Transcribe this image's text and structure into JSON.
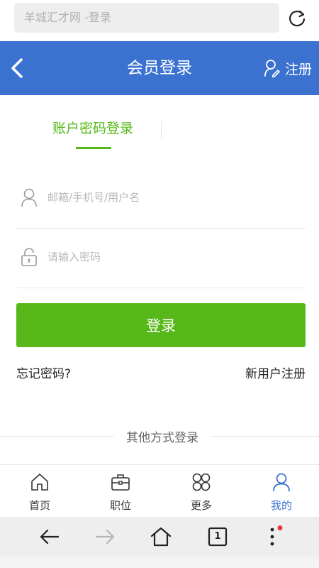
{
  "browser": {
    "url_text": "羊城汇才网 -登录",
    "tab_count": "1"
  },
  "header": {
    "title": "会员登录",
    "register_label": "注册"
  },
  "login_tabs": [
    {
      "label": "账户密码登录",
      "active": true
    }
  ],
  "form": {
    "username_placeholder": "邮箱/手机号/用户名",
    "password_placeholder": "请输入密码",
    "submit_label": "登录",
    "forgot_label": "忘记密码?",
    "new_user_label": "新用户注册",
    "other_methods_label": "其他方式登录"
  },
  "tabbar": {
    "items": [
      {
        "label": "首页",
        "icon": "home-icon",
        "active": false
      },
      {
        "label": "职位",
        "icon": "briefcase-icon",
        "active": false
      },
      {
        "label": "更多",
        "icon": "more-grid-icon",
        "active": false
      },
      {
        "label": "我的",
        "icon": "user-icon",
        "active": true
      }
    ]
  },
  "colors": {
    "header_blue": "#3b72d0",
    "accent_green": "#58b719",
    "notification_red": "#e53935"
  }
}
